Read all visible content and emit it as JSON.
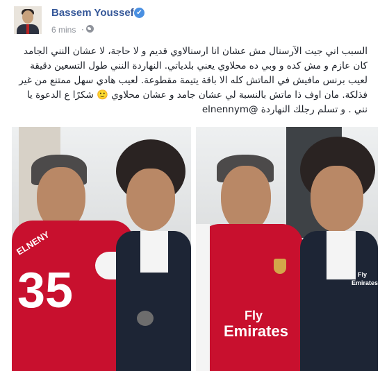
{
  "post": {
    "author": "Bassem Youssef",
    "timestamp": "6 mins",
    "dot": "·",
    "verified_mark": "✔",
    "body": "السبب اني جيت الآرسنال مش عشان انا ارسنالاوي قديم و لا حاجة، لا عشان النني الجامد كان عازم و مش كده و وبي ده محلاوي يعني بلدياتي. النهاردة النني طول التسعين دقيقة لعيب برنس مافيش في الماتش كله الا باقة يتيمة مقطوعة. لعيب هادي سهل ممتنع من غير فذلكة. مان اوف ذا ماتش بالنسبة لي عشان جامد و عشان محلاوي 🙂 شكرًا ع الدعوة يا نني . و تسلم رجلك النهاردة @elnennym"
  },
  "photo": {
    "left_shirt_name": "ELNENY",
    "left_shirt_number": "35",
    "right_shirt_sponsor_line1": "Fly",
    "right_shirt_sponsor_line2": "Emirates",
    "jacket_sponsor_line1": "Fly",
    "jacket_sponsor_line2": "Emirates"
  },
  "colors": {
    "name_link": "#365899",
    "meta_gray": "#90949c",
    "arsenal_red": "#c8102e"
  },
  "icons": [
    "verified-badge-icon",
    "globe-icon",
    "avatar-photo"
  ]
}
